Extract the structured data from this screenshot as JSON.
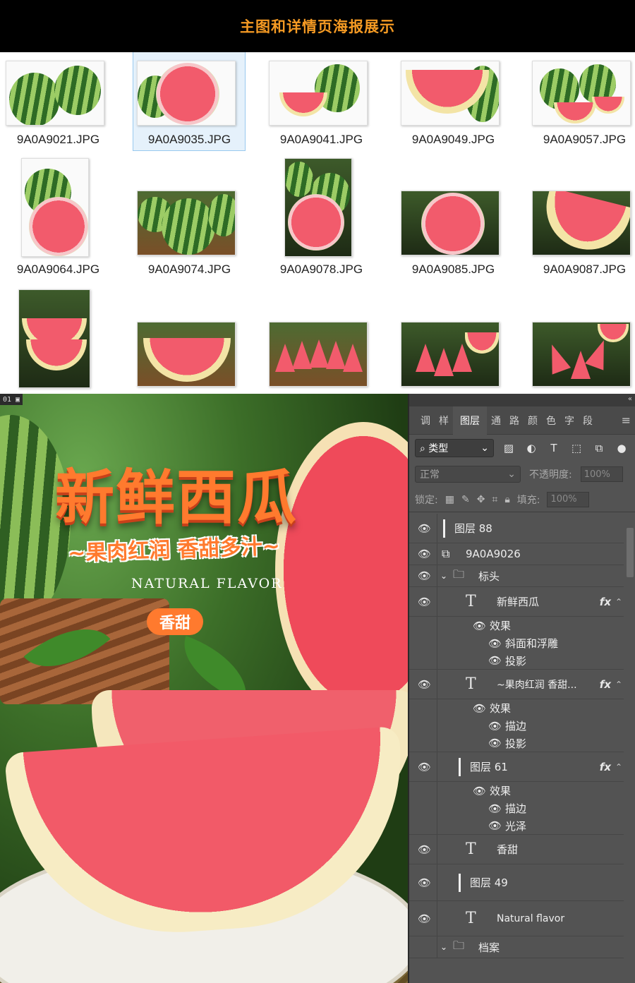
{
  "header": {
    "title": "主图和详情页海报展示"
  },
  "files": [
    {
      "name": "9A0A9021.JPG"
    },
    {
      "name": "9A0A9035.JPG"
    },
    {
      "name": "9A0A9041.JPG"
    },
    {
      "name": "9A0A9049.JPG"
    },
    {
      "name": "9A0A9057.JPG"
    },
    {
      "name": "9A0A9064.JPG"
    },
    {
      "name": "9A0A9074.JPG"
    },
    {
      "name": "9A0A9078.JPG"
    },
    {
      "name": "9A0A9085.JPG"
    },
    {
      "name": "9A0A9087.JPG"
    }
  ],
  "poster": {
    "tab_label": "01",
    "title": "新鲜西瓜",
    "subtitle": "~果肉红润 香甜多汁~",
    "english": "NATURAL FLAVOR",
    "badge": "香甜"
  },
  "panel": {
    "tabs": [
      "调",
      "样",
      "图层",
      "通",
      "路",
      "颜",
      "色",
      "字",
      "段"
    ],
    "filter_label": "类型",
    "blend_mode": "正常",
    "opacity_label": "不透明度:",
    "opacity_value": "100%",
    "lock_label": "锁定:",
    "fill_label": "填充:",
    "fill_value": "100%",
    "layers": {
      "l88": "图层 88",
      "img": "9A0A9026",
      "group": "标头",
      "t1": "新鲜西瓜",
      "t1_effects": "效果",
      "t1_e1": "斜面和浮雕",
      "t1_e2": "投影",
      "t2": "~果肉红润 香甜...",
      "t2_effects": "效果",
      "t2_e1": "描边",
      "t2_e2": "投影",
      "l61": "图层 61",
      "l61_effects": "效果",
      "l61_e1": "描边",
      "l61_e2": "光泽",
      "t3": "香甜",
      "l49": "图层 49",
      "t4": "Natural flavor",
      "group2": "档案"
    },
    "fx_label": "fx"
  }
}
